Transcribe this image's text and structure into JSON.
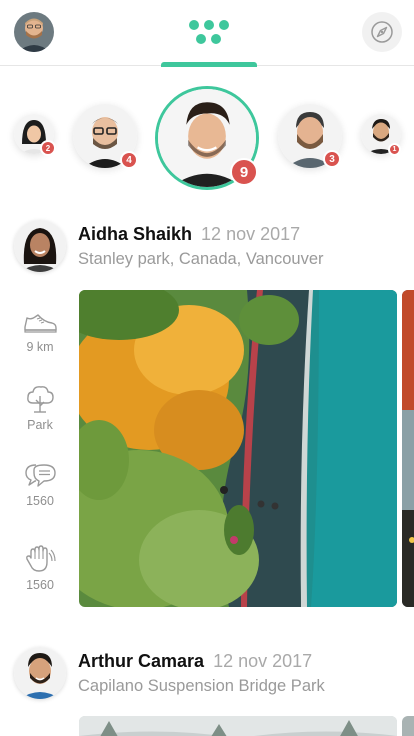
{
  "header": {
    "me_avatar_icon": "user-avatar",
    "feed_tab_icon": "dots-grid-icon",
    "explore_icon": "compass-icon",
    "accent": "#3ec79c"
  },
  "stories": [
    {
      "badge": "2"
    },
    {
      "badge": "4"
    },
    {
      "badge": "9",
      "active": true
    },
    {
      "badge": "3"
    },
    {
      "badge": "1"
    }
  ],
  "badge_color": "#d9534f",
  "posts": [
    {
      "author": "Aidha Shaikh",
      "date": "12 nov 2017",
      "location": "Stanley park, Canada, Vancouver",
      "stats": [
        {
          "icon": "shoe-icon",
          "label": "9 km"
        },
        {
          "icon": "tree-icon",
          "label": "Park"
        },
        {
          "icon": "comments-icon",
          "label": "1560"
        },
        {
          "icon": "clap-icon",
          "label": "1560"
        }
      ]
    },
    {
      "author": "Arthur Camara",
      "date": "12 nov 2017",
      "location": "Capilano Suspension Bridge Park"
    }
  ]
}
